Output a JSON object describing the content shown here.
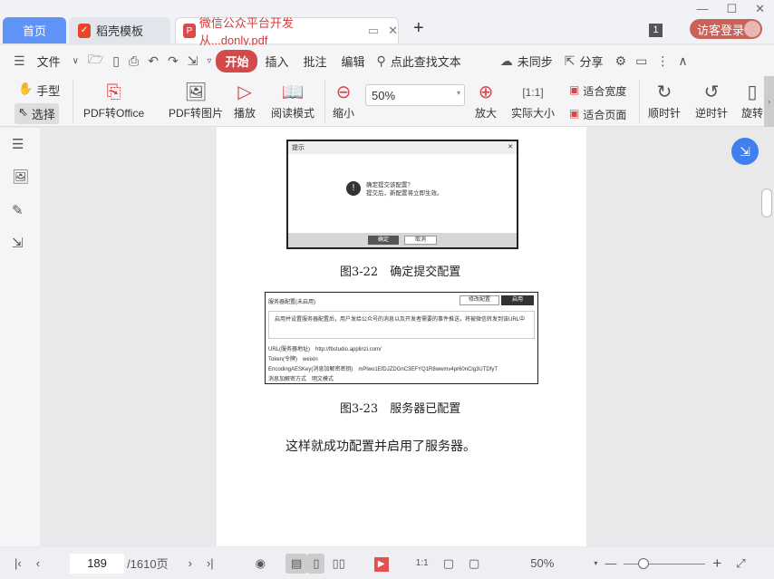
{
  "tabs": {
    "home": "首页",
    "template": "稻壳模板",
    "doc": "微信公众平台开发从...donly.pdf",
    "add": "+"
  },
  "window": {
    "minimize": "—",
    "maximize": "☐",
    "close": "✕",
    "count": "1",
    "login": "访客登录"
  },
  "menu": {
    "file": "文件",
    "start": "开始",
    "insert": "插入",
    "annotate": "批注",
    "edit": "编辑",
    "search": "点此查找文本",
    "sync": "未同步",
    "share": "分享"
  },
  "ribbon": {
    "hand": "手型",
    "select": "选择",
    "pdf_office": "PDF转Office",
    "pdf_image": "PDF转图片",
    "play": "播放",
    "read_mode": "阅读模式",
    "zoom_out": "缩小",
    "zoom_value": "50%",
    "zoom_in": "放大",
    "actual_size": "实际大小",
    "fit_width": "适合宽度",
    "fit_page": "适合页面",
    "clockwise": "顺时针",
    "counter": "逆时针",
    "rotate": "旋转"
  },
  "document": {
    "dialog": {
      "title": "提示",
      "close": "✕",
      "question": "确定提交该配置？",
      "note": "提交后，新配置将立即生效。",
      "ok": "确定",
      "cancel": "取消"
    },
    "caption1": "图3-22　确定提交配置",
    "server": {
      "title": "服务器配置(未启用)",
      "modify": "修改配置",
      "enable": "启用",
      "desc": "启用并设置服务器配置后，用户发给公众号的消息以及开发者需要的事件推送，将被微信转发到该URL中",
      "url": "URL(服务器地址)　http://fbstudio.applinzi.com/",
      "token": "Token(令牌)　weixin",
      "aes": "EncodingAESKey(消息加解密密钥)　mPlwo1EfDJZDGnC3EFYQ1R8wwmv4pr60nClg3UTDfyT",
      "mode": "消息加解密方式　明文模式"
    },
    "caption2": "图3-23　服务器已配置",
    "body": "这样就成功配置并启用了服务器。"
  },
  "status": {
    "page": "189",
    "total": "/1610页",
    "zoom": "50%",
    "zoom_level_percent": 50
  }
}
